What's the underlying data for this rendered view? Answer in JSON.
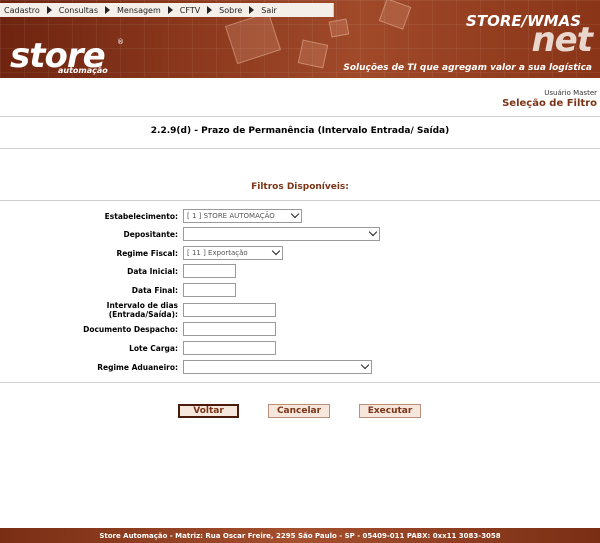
{
  "menu": {
    "items": [
      "Cadastro",
      "Consultas",
      "Mensagem",
      "CFTV",
      "Sobre",
      "Sair"
    ]
  },
  "banner": {
    "logo": "store",
    "logo_reg": "®",
    "logo_sub": "automação",
    "brand_line1": "STORE/WMAS",
    "brand_line2": "net",
    "tagline": "Soluções de TI que agregam valor a sua logística"
  },
  "header": {
    "user": "Usuário Master",
    "page_heading": "Seleção de Filtro"
  },
  "report_title": "2.2.9(d) - Prazo de Permanência (Intervalo Entrada/ Saída)",
  "filters_title": "Filtros Disponíveis:",
  "form": {
    "estabelecimento_label": "Estabelecimento:",
    "estabelecimento_value": "[ 1 ] STORE AUTOMAÇÃO",
    "depositante_label": "Depositante:",
    "depositante_value": "",
    "regime_fiscal_label": "Regime Fiscal:",
    "regime_fiscal_value": "[ 11 ] Exportação",
    "data_inicial_label": "Data Inicial:",
    "data_inicial_value": "",
    "data_final_label": "Data Final:",
    "data_final_value": "",
    "intervalo_label_1": "Intervalo de dias",
    "intervalo_label_2": "(Entrada/Saída):",
    "intervalo_value": "",
    "documento_label": "Documento Despacho:",
    "documento_value": "",
    "lote_label": "Lote Carga:",
    "lote_value": "",
    "regime_aduaneiro_label": "Regime Aduaneiro:",
    "regime_aduaneiro_value": ""
  },
  "buttons": {
    "voltar": "Voltar",
    "cancelar": "Cancelar",
    "executar": "Executar"
  },
  "footer": "Store Automação - Matriz: Rua Oscar Freire, 2295 São Paulo - SP - 05409-011 PABX: 0xx11 3083-3058"
}
